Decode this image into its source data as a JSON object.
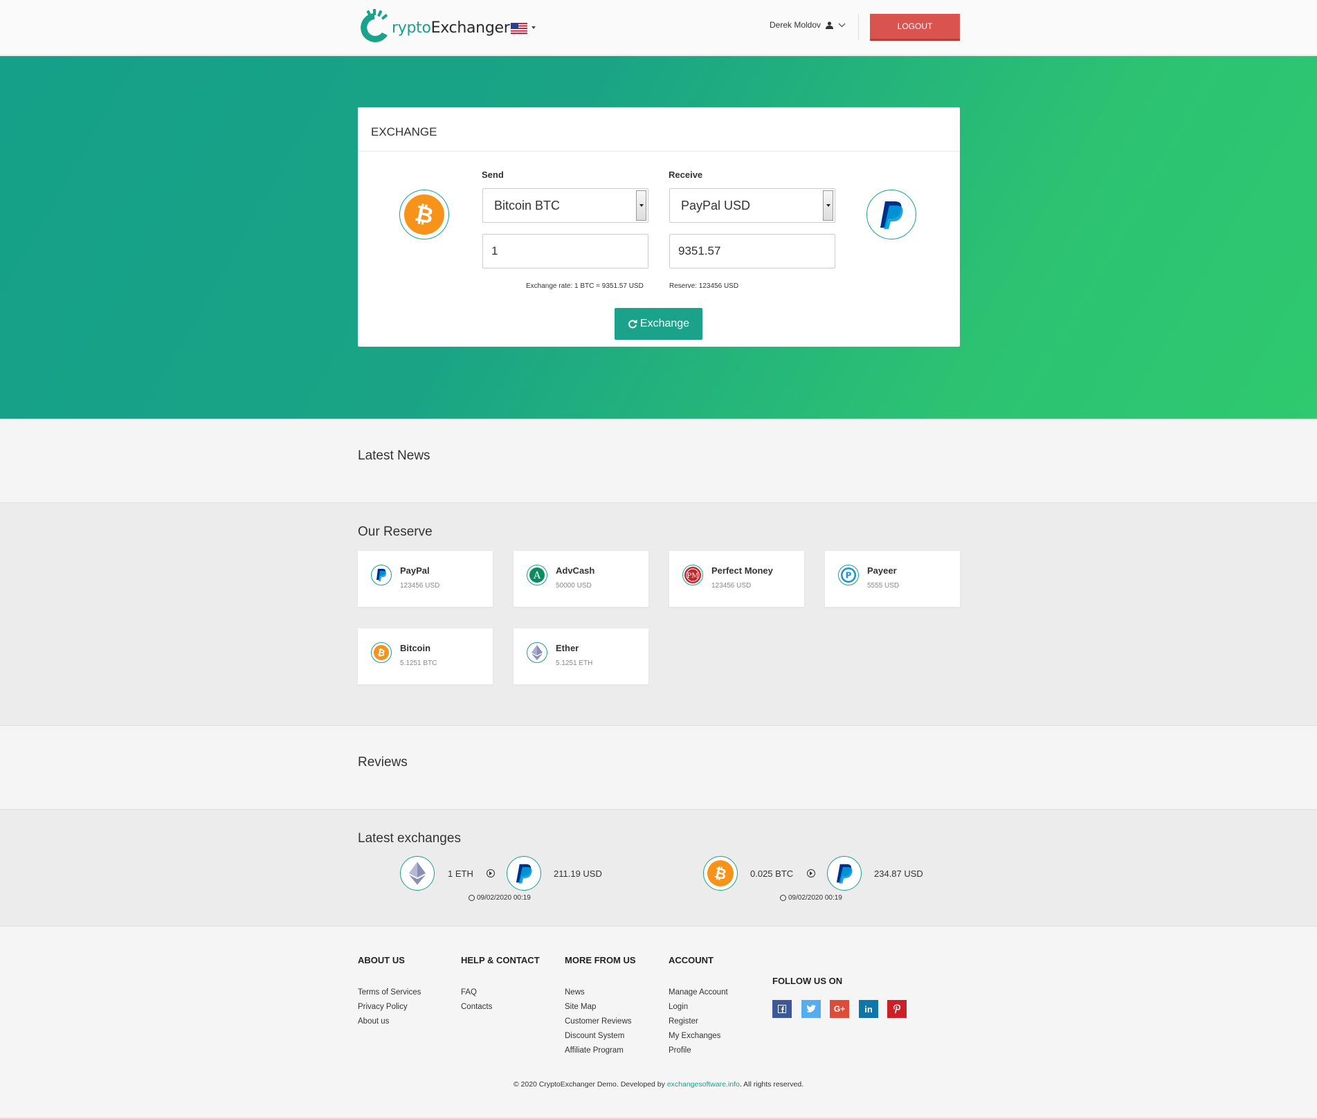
{
  "header": {
    "logo_prefix": "C",
    "logo_accent": "rypto",
    "logo_rest": "Exchanger",
    "user_name": "Derek Moldov",
    "logout_label": "LOGOUT"
  },
  "exchange": {
    "title": "EXCHANGE",
    "send_label": "Send",
    "receive_label": "Receive",
    "send_currency": "Bitcoin BTC",
    "receive_currency": "PayPal USD",
    "send_amount": "1",
    "receive_amount": "9351.57",
    "rate_text": "Exchange rate: 1 BTC = 9351.57 USD",
    "reserve_text": "Reserve: 123456 USD",
    "button_label": "Exchange"
  },
  "sections": {
    "latest_news": "Latest News",
    "our_reserve": "Our Reserve",
    "reviews": "Reviews",
    "latest_exchanges": "Latest exchanges"
  },
  "reserves": [
    {
      "name": "PayPal",
      "amount": "123456 USD",
      "icon": "paypal-icon"
    },
    {
      "name": "AdvCash",
      "amount": "50000 USD",
      "icon": "advcash-icon"
    },
    {
      "name": "Perfect Money",
      "amount": "123456 USD",
      "icon": "perfect-money-icon"
    },
    {
      "name": "Payeer",
      "amount": "5555 USD",
      "icon": "payeer-icon"
    },
    {
      "name": "Bitcoin",
      "amount": "5.1251 BTC",
      "icon": "bitcoin-icon"
    },
    {
      "name": "Ether",
      "amount": "5.1251 ETH",
      "icon": "ether-icon"
    }
  ],
  "latest_exchanges": [
    {
      "send": "1 ETH",
      "receive": "211.19 USD",
      "date": "09/02/2020 00:19"
    },
    {
      "send": "0.025 BTC",
      "receive": "234.87 USD",
      "date": "09/02/2020 00:19"
    }
  ],
  "footer": {
    "about_us": {
      "heading": "ABOUT US",
      "links": [
        "Terms of Services",
        "Privacy Policy",
        "About us"
      ]
    },
    "help": {
      "heading": "HELP & CONTACT",
      "links": [
        "FAQ",
        "Contacts"
      ]
    },
    "more": {
      "heading": "MORE FROM US",
      "links": [
        "News",
        "Site Map",
        "Customer Reviews",
        "Discount System",
        "Affiliate Program"
      ]
    },
    "account": {
      "heading": "ACCOUNT",
      "links": [
        "Manage Account",
        "Login",
        "Register",
        "My Exchanges",
        "Profile"
      ]
    },
    "follow": {
      "heading": "FOLLOW US ON"
    },
    "copyright_prefix": "© 2020 CryptoExchanger Demo. Developed by ",
    "copyright_link": "exchangesoftware.info",
    "copyright_suffix": ". All rights reserved."
  },
  "colors": {
    "accent": "#1aa38a",
    "logout": "#d9534f",
    "bitcoin": "#f7931a",
    "paypal_dark": "#003087",
    "paypal_light": "#009cde"
  }
}
